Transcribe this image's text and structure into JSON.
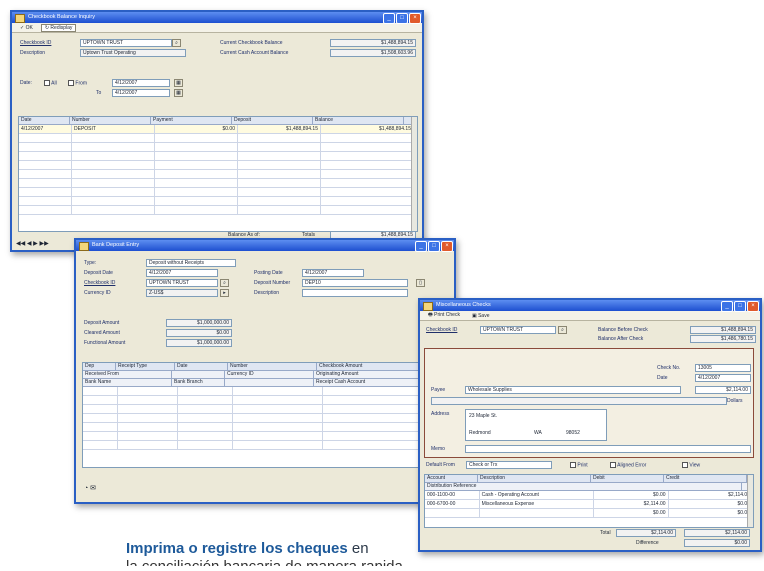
{
  "w1": {
    "title": "Checkbook Balance Inquiry",
    "toolbar": {
      "ok": "OK",
      "redisplay": "Redisplay"
    },
    "checkbook_id_label": "Checkbook ID",
    "checkbook_id_value": "UPTOWN TRUST",
    "description_label": "Description",
    "description_value": "Uptown Trust Operating",
    "current_checkbook_balance_label": "Current Checkbook Balance",
    "current_checkbook_balance_value": "$1,488,894.15",
    "current_cash_account_balance_label": "Current Cash Account Balance",
    "current_cash_account_balance_value": "$1,508,603.96",
    "date_label": "Date:",
    "all_label": "All",
    "from_label": "From",
    "to_label": "To",
    "from_value": "4/12/2007",
    "to_value": "4/12/2007",
    "columns": [
      "Date",
      "Number",
      "Payment",
      "Deposit",
      "Balance"
    ],
    "rows": [
      [
        "4/12/2007",
        "DEPOSIT",
        "$0.00",
        "$1,488,894.15",
        "$1,488,894.15"
      ]
    ],
    "balance_label": "Balance As of:",
    "totals_label": "Totals",
    "totals_value": "$1,488,894.15"
  },
  "w2": {
    "title": "Bank Deposit Entry",
    "type_label": "Type:",
    "type_value": "Deposit without Receipts",
    "deposit_date_label": "Deposit Date",
    "deposit_date_value": "4/12/2007",
    "checkbook_id_label": "Checkbook ID",
    "checkbook_id_value": "UPTOWN TRUST",
    "currency_id_label": "Currency ID",
    "currency_id_value": "Z-US$",
    "posting_date_label": "Posting Date",
    "posting_date_value": "4/12/2007",
    "deposit_number_label": "Deposit Number",
    "deposit_number_value": "DEP10",
    "description_label": "Description",
    "deposit_amount_label": "Deposit Amount",
    "deposit_amount_value": "$1,000,000.00",
    "cleared_amount_label": "Cleared Amount",
    "cleared_amount_value": "$0.00",
    "functional_amount_label": "Functional Amount",
    "functional_amount_value": "$1,000,000.00",
    "grid_cols": [
      "Dep",
      "Receipt Type",
      "Date",
      "Number",
      "Checkbook Amount"
    ],
    "grid_sub1": [
      "Received From",
      "",
      "",
      "Currency ID",
      "Originating Amount"
    ],
    "grid_sub2": [
      "Bank Name",
      "",
      "Bank Branch",
      "",
      "Receipt Cash Account"
    ]
  },
  "w3": {
    "title": "Miscellaneous Checks",
    "toolbar": {
      "print_check": "Print Check",
      "save": "Save"
    },
    "checkbook_id_label": "Checkbook ID",
    "checkbook_id_value": "UPTOWN TRUST",
    "balance_label1": "Balance Before Check",
    "balance_value1": "$1,488,894.15",
    "balance_label2": "Balance After Check",
    "balance_value2": "$1,486,780.15",
    "check_no_label": "Check No.",
    "check_no_value": "13005",
    "date_label": "Date",
    "date_value": "4/12/2007",
    "payee_label": "Payee",
    "payee_value": "Wholesale Supplies",
    "amount_value": "$2,114.00",
    "address_label": "Address",
    "address_value": "23 Maple St.",
    "city_value": "Redmond",
    "state_value": "WA",
    "zip_value": "98052",
    "dollars_label": "Dollars",
    "memo_label": "Memo",
    "default_from_label": "Default From",
    "default_from_value": "Check or Trx",
    "print_label": "Print",
    "aligned_label": "Aligned Error",
    "view_label": "View",
    "grid_cols": [
      "Account",
      "Description",
      "Debit",
      "Credit"
    ],
    "grid_sub": "Distribution Reference",
    "rows": [
      [
        "000-1100-00",
        "Cash - Operating Account",
        "$0.00",
        "$2,114.00"
      ],
      [
        "000-6700-00",
        "Miscellaneous Expense",
        "$2,114.00",
        "$0.00"
      ],
      [
        "",
        "",
        "$0.00",
        "$0.00"
      ]
    ],
    "total_label": "Total",
    "total_debit": "$2,114.00",
    "total_credit": "$2,114.00",
    "difference_label": "Difference",
    "difference_value": "$0.00"
  },
  "caption": {
    "bold": "Imprima o registre los cheques",
    "rest": "en",
    "line2": "la conciliación bancaria de manera rapida"
  },
  "colors": {
    "titlebar": "#2a5fc4",
    "window_bg": "#ece9d8",
    "caption_accent": "#1e5a9a"
  }
}
